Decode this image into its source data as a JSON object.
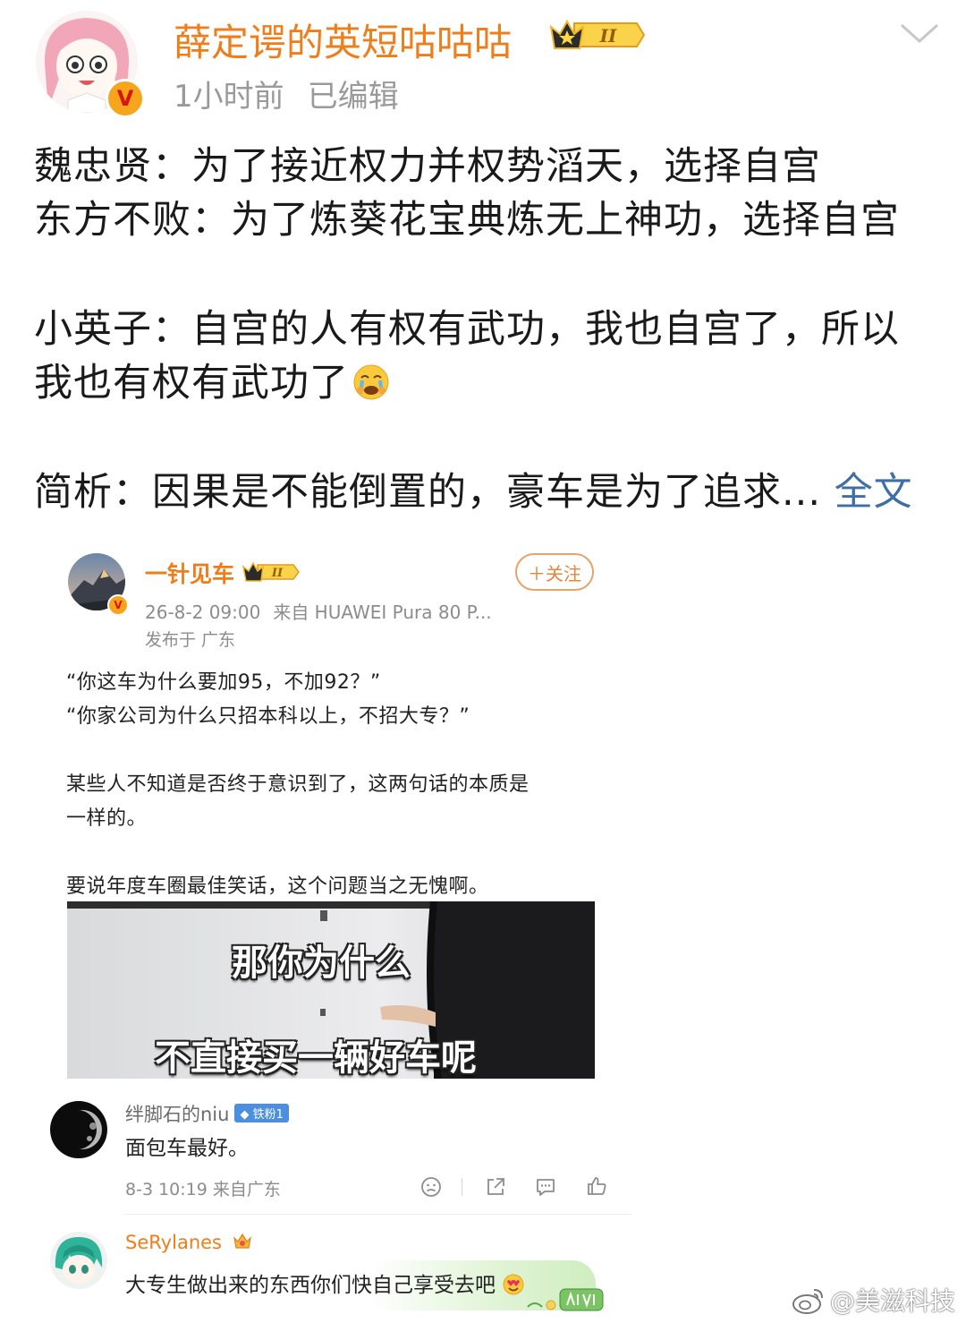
{
  "post": {
    "author": "薛定谔的英短咕咕咕",
    "level_badge": "II",
    "time": "1小时前",
    "edited": "已编辑",
    "lines": [
      "魏忠贤：为了接近权力并权势滔天，选择自宫",
      "东方不败：为了炼葵花宝典炼无上神功，选择自宫",
      "小英子：自宫的人有权有武功，我也自宫了，所以",
      "我也有权有武功了",
      "简析：因果是不能倒置的，豪车是为了追求..."
    ],
    "full_text_link": "全文"
  },
  "embedded": {
    "author": "一针见车",
    "level_badge": "II",
    "follow_label": "＋关注",
    "date": "26-8-2 09:00",
    "source": "来自 HUAWEI Pura 80 P...",
    "location": "发布于 广东",
    "body": [
      "“你这车为什么要加95，不加92？”",
      "“你家公司为什么只招本科以上，不招大专？”",
      "某些人不知道是否终于意识到了，这两句话的本质是",
      "一样的。",
      "要说年度车圈最佳笑话，这个问题当之无愧啊。"
    ],
    "meme_captions": [
      "那你为什么",
      "不直接买一辆好车呢"
    ],
    "comments": [
      {
        "name": "绊脚石的niu",
        "badge": "铁粉1",
        "text": "面包车最好。",
        "time": "8-3 10:19  来自广东"
      },
      {
        "name": "SeRylanes",
        "text": "大专生做出来的东西你们快自己享受去吧"
      }
    ]
  },
  "watermark": "@美滋科技",
  "colors": {
    "author_orange": "#ef7d1a",
    "link_blue": "#3d6ea8",
    "meta_gray": "#9a9a9a"
  }
}
